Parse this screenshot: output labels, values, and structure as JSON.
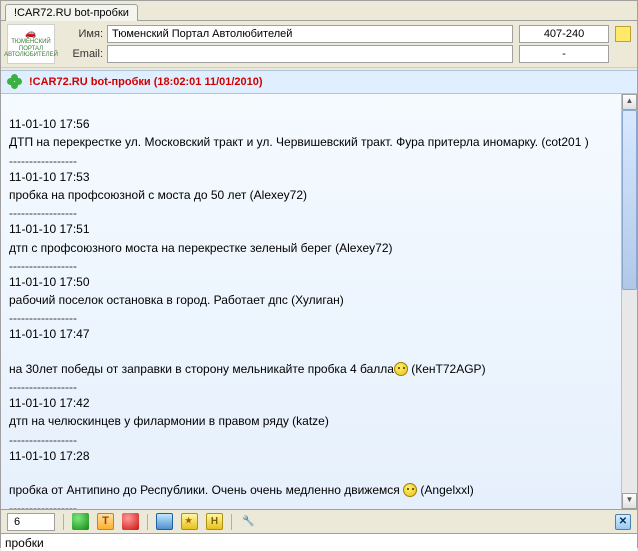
{
  "tab": {
    "title": "!CAR72.RU bot-пробки"
  },
  "avatar": {
    "line1": "CAR72.RU",
    "line2": "ТЮМЕНСКИЙ",
    "line3": "ПОРТАЛ",
    "line4": "АВТОЛЮБИТЕЛЕЙ"
  },
  "fields": {
    "name_label": "Имя:",
    "name_value": "Тюменский Портал Автолюбителей",
    "email_label": "Email:",
    "email_value": ""
  },
  "side": {
    "top": "407-240",
    "bottom": "-"
  },
  "header": {
    "title": "!CAR72.RU bot-пробки (18:02:01 11/01/2010)"
  },
  "messages": [
    {
      "ts": "11-01-10 17:56",
      "text": "ДТП на перекрестке ул. Московский тракт и ул. Червишевский тракт. Фура притерла иномарку. (cot201 )"
    },
    {
      "ts": "11-01-10 17:53",
      "text": "пробка на профсоюзной с моста до 50 лет (Alexey72)"
    },
    {
      "ts": "11-01-10 17:51",
      "text": "дтп с профсоюзного моста на перекрестке  зеленый берег (Alexey72)"
    },
    {
      "ts": "11-01-10 17:50",
      "text": "рабочий поселок остановка в город. Работает дпс (Хулиган)"
    },
    {
      "ts": "11-01-10 17:47",
      "text_pre": "на 30лет победы от заправки в сторону мельникайте пробка 4 балла",
      "smiley": true,
      "text_post": " (КенТ72AGP)"
    },
    {
      "ts": "11-01-10 17:42",
      "text": "дтп на челюскинцев у филармонии в правом ряду (katze)"
    },
    {
      "ts": "11-01-10 17:28",
      "text_pre": "пробка от Антипино до Республики. Очень очень медленно движемся  ",
      "smiley": true,
      "text_post": "  (Angelxxl)"
    }
  ],
  "sep": "-----------------",
  "toolbar": {
    "page": "6",
    "t_label": "T",
    "h_label": "H"
  },
  "input": {
    "value": "пробки"
  }
}
